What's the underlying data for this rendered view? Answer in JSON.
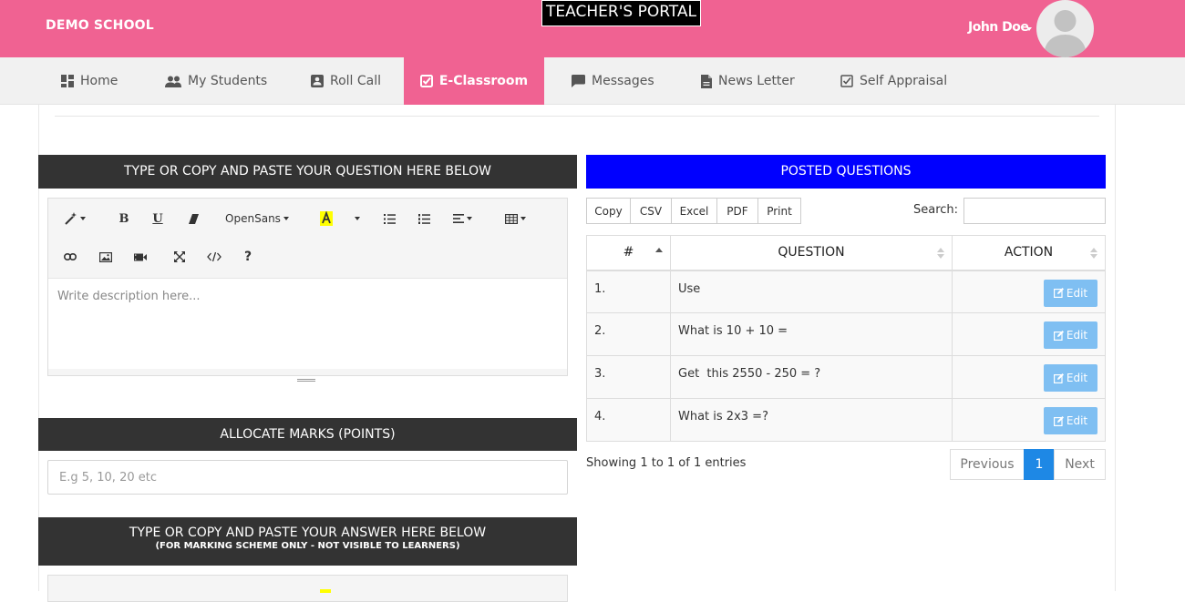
{
  "header": {
    "school_name": "DEMO SCHOOL",
    "portal_title": "TEACHER'S PORTAL",
    "user_name": "John Doe"
  },
  "nav": {
    "items": [
      {
        "label": "Home",
        "icon": "dashboard-icon"
      },
      {
        "label": "My Students",
        "icon": "people-icon"
      },
      {
        "label": "Roll Call",
        "icon": "contact-card-icon"
      },
      {
        "label": "E-Classroom",
        "icon": "checkbox-icon",
        "active": true
      },
      {
        "label": "Messages",
        "icon": "message-icon"
      },
      {
        "label": "News Letter",
        "icon": "document-icon"
      },
      {
        "label": "Self Appraisal",
        "icon": "checkbox-outline-icon"
      }
    ]
  },
  "question_section": {
    "title": "TYPE OR COPY AND PASTE YOUR QUESTION HERE BELOW",
    "editor": {
      "font_name": "OpenSans",
      "placeholder": "Write description here..."
    }
  },
  "marks_section": {
    "title": "ALLOCATE MARKS (POINTS)",
    "placeholder": "E.g 5, 10, 20 etc"
  },
  "answer_section": {
    "title": "TYPE OR COPY AND PASTE YOUR ANSWER HERE BELOW",
    "subtitle": "(FOR MARKING SCHEME ONLY - NOT VISIBLE TO LEARNERS)"
  },
  "posted": {
    "title": "POSTED QUESTIONS",
    "buttons": [
      "Copy",
      "CSV",
      "Excel",
      "PDF",
      "Print"
    ],
    "search_label": "Search:",
    "columns": [
      "#",
      "QUESTION",
      "ACTION"
    ],
    "rows": [
      {
        "num": "1.",
        "question": "Use",
        "action": "Edit"
      },
      {
        "num": "2.",
        "question": "What is 10 + 10 =",
        "action": "Edit"
      },
      {
        "num": "3.",
        "question": "Get  this 2550 - 250 = ?",
        "action": "Edit"
      },
      {
        "num": "4.",
        "question": "What is 2x3 =?",
        "action": "Edit"
      }
    ],
    "info": "Showing 1 to 1 of 1 entries",
    "pagination": {
      "previous": "Previous",
      "page": "1",
      "next": "Next"
    }
  },
  "colors": {
    "header_pink": "#f06292",
    "posted_blue": "#0000ff",
    "section_dark": "#333333",
    "edit_button": "#7fbff2",
    "page_active": "#1e88e5"
  }
}
